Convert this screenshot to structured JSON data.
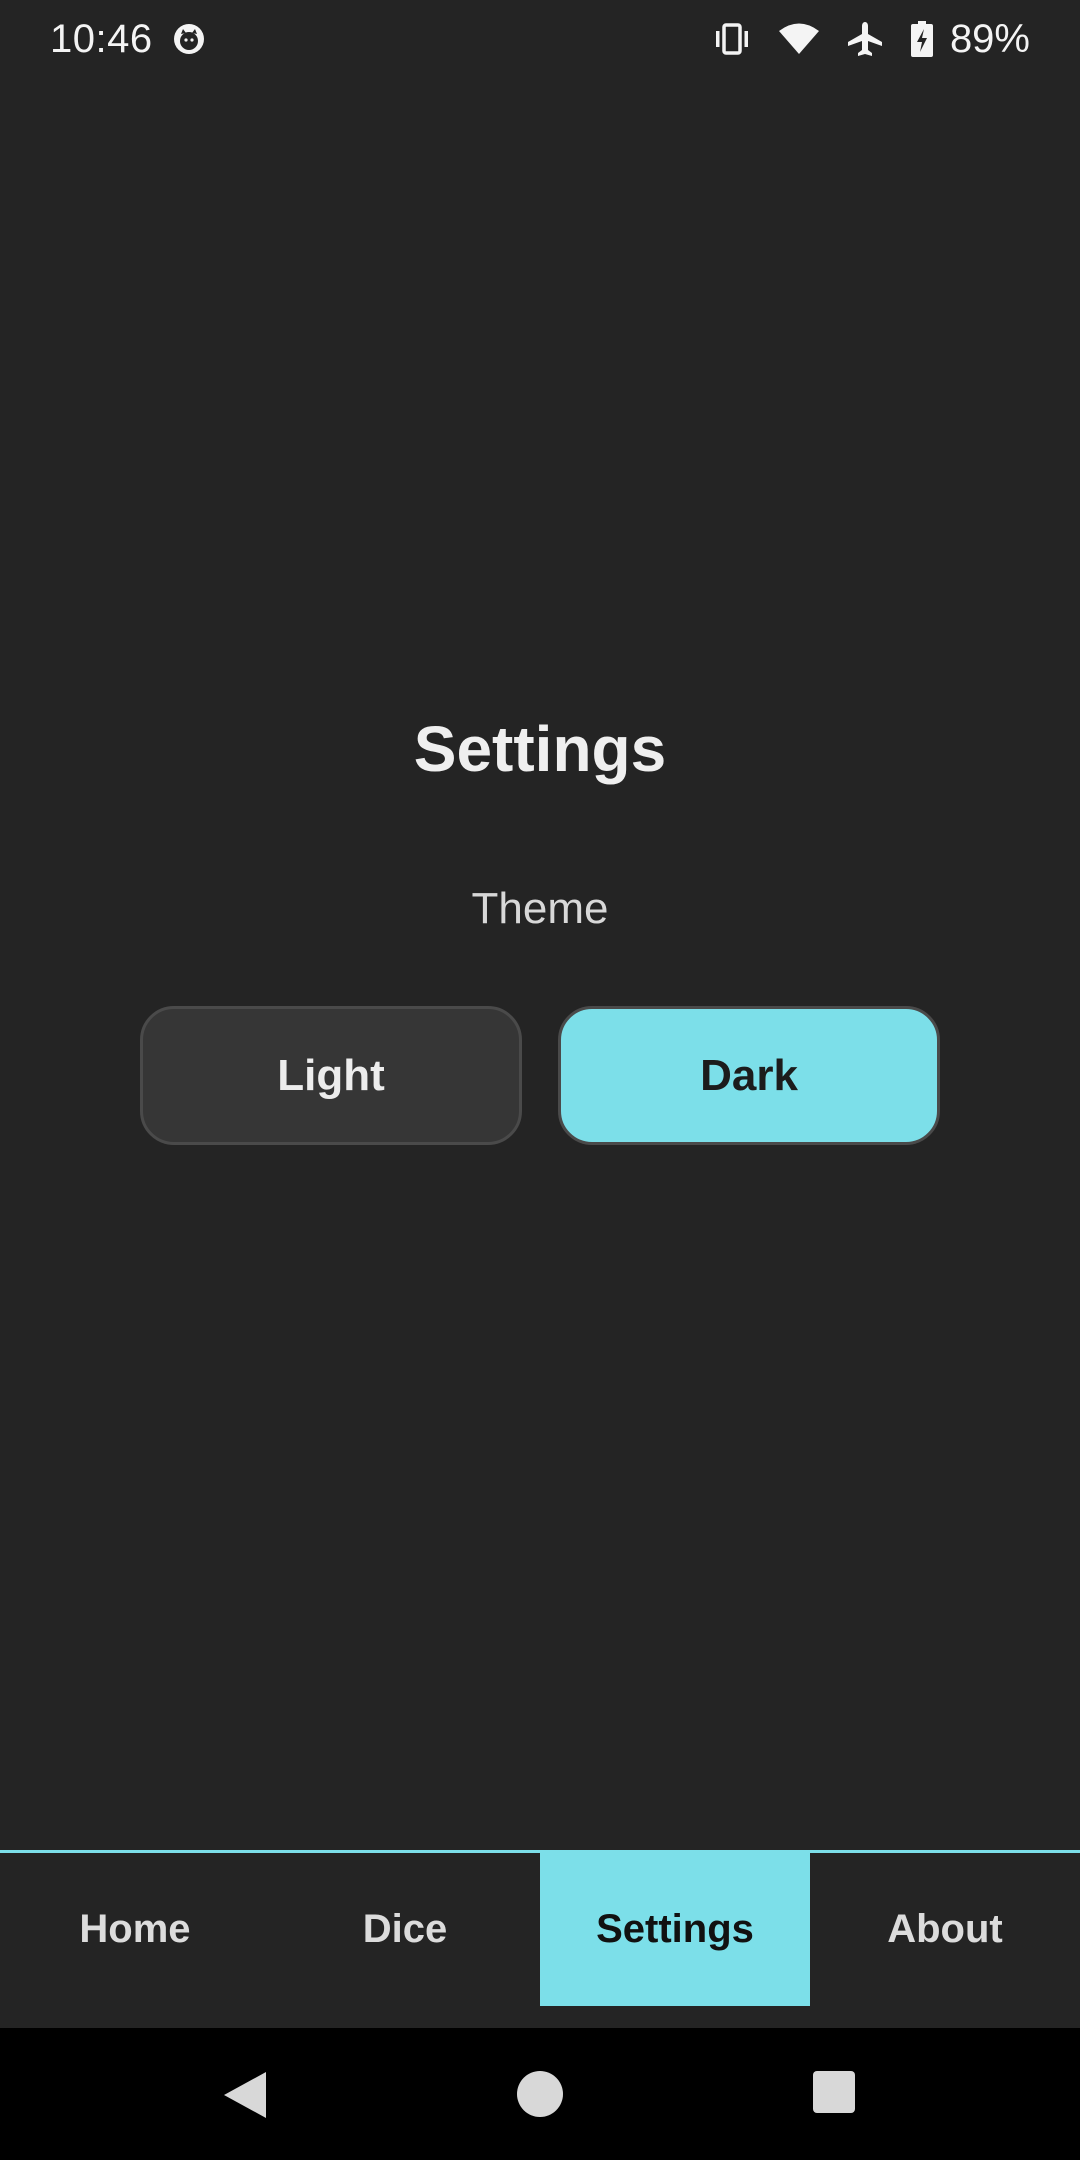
{
  "status_bar": {
    "time": "10:46",
    "battery_percent": "89%",
    "icons": [
      "cat-face-icon",
      "vibrate-icon",
      "wifi-icon",
      "airplane-icon",
      "battery-charging-icon"
    ]
  },
  "main": {
    "title": "Settings",
    "theme_label": "Theme",
    "theme_options": [
      {
        "label": "Light",
        "selected": false
      },
      {
        "label": "Dark",
        "selected": true
      }
    ]
  },
  "bottom_nav": {
    "items": [
      {
        "label": "Home",
        "active": false
      },
      {
        "label": "Dice",
        "active": false
      },
      {
        "label": "Settings",
        "active": true
      },
      {
        "label": "About",
        "active": false
      }
    ]
  },
  "system_nav": {
    "icons": [
      "back-icon",
      "home-icon",
      "recents-icon"
    ]
  },
  "colors": {
    "background": "#242424",
    "accent": "#7cdfe9",
    "button_inactive": "#363636",
    "system_nav": "#000000"
  }
}
